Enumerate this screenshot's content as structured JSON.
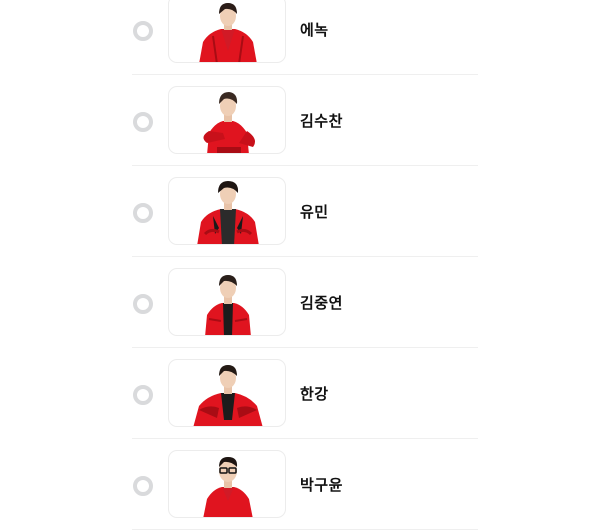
{
  "options": [
    {
      "name": "에녹",
      "photo_icon": "member-photo",
      "inner_shirt": "#d11a26",
      "selected": false
    },
    {
      "name": "김수찬",
      "photo_icon": "member-photo",
      "inner_shirt": "#d11a26",
      "selected": false
    },
    {
      "name": "유민",
      "photo_icon": "member-photo",
      "inner_shirt": "#2b2b2b",
      "selected": false
    },
    {
      "name": "김중연",
      "photo_icon": "member-photo",
      "inner_shirt": "#1c1c1c",
      "selected": false
    },
    {
      "name": "한강",
      "photo_icon": "member-photo",
      "inner_shirt": "#1c1c1c",
      "selected": false
    },
    {
      "name": "박구윤",
      "photo_icon": "member-photo",
      "inner_shirt": "#d11a26",
      "selected": false
    }
  ],
  "colors": {
    "jacket": "#e0141f",
    "jacket_shade": "#a90c14",
    "radio_border": "#d9dadc",
    "divider": "#efefef"
  }
}
